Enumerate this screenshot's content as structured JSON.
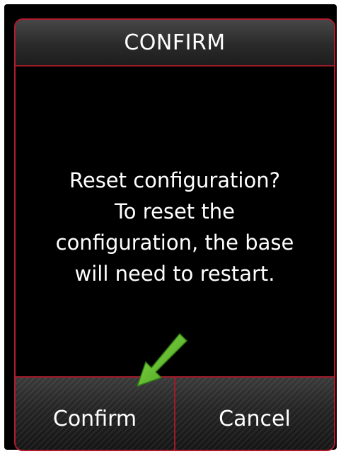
{
  "dialog": {
    "title": "CONFIRM",
    "message_lines": [
      "Reset configuration?",
      "To reset the",
      "configuration, the base",
      "will need to restart."
    ]
  },
  "buttons": {
    "confirm_label": "Confirm",
    "cancel_label": "Cancel"
  },
  "colors": {
    "accent": "#b01c2e",
    "pointer_arrow": "#5fbf2a"
  },
  "icons": {
    "pointer": "green-arrow-icon"
  }
}
